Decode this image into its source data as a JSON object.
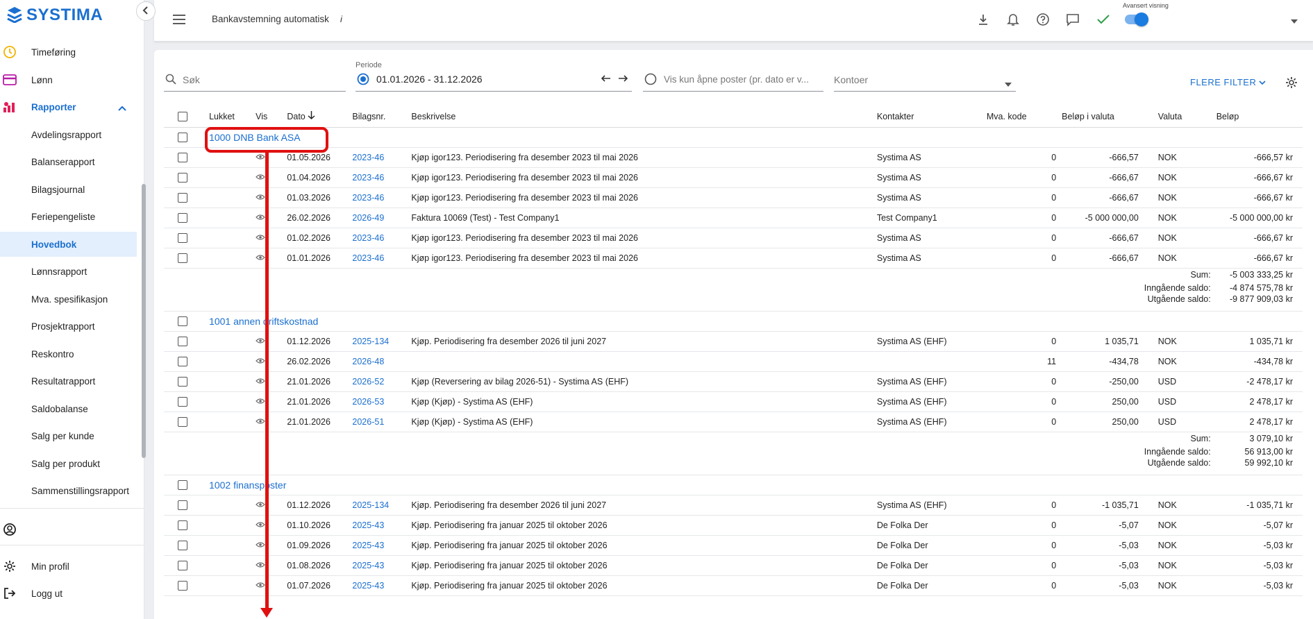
{
  "app": {
    "logo": "SYSTIMA"
  },
  "sidebar": {
    "items": [
      {
        "label": "Timeføring",
        "icon": "clock-icon"
      },
      {
        "label": "Lønn",
        "icon": "payment-card-icon"
      },
      {
        "label": "Rapporter",
        "icon": "reports-icon"
      },
      {
        "label": "Avdelingsrapport"
      },
      {
        "label": "Balanserapport"
      },
      {
        "label": "Bilagsjournal"
      },
      {
        "label": "Feriepengeliste"
      },
      {
        "label": "Hovedbok"
      },
      {
        "label": "Lønnsrapport"
      },
      {
        "label": "Mva. spesifikasjon"
      },
      {
        "label": "Prosjektrapport"
      },
      {
        "label": "Reskontro"
      },
      {
        "label": "Resultatrapport"
      },
      {
        "label": "Saldobalanse"
      },
      {
        "label": "Salg per kunde"
      },
      {
        "label": "Salg per produkt"
      },
      {
        "label": "Sammenstillingsrapport"
      }
    ],
    "bottom": {
      "profile": "Min profil",
      "logout": "Logg ut"
    }
  },
  "topbar": {
    "title": "Bankavstemning automatisk",
    "info": "i",
    "advanced_label": "Avansert visning"
  },
  "filters": {
    "search_placeholder": "Søk",
    "period_label": "Periode",
    "period_value": "01.01.2026 - 31.12.2026",
    "open_posts_label": "Vis kun åpne poster (pr. dato er v...",
    "accounts_placeholder": "Kontoer",
    "more_filters": "FLERE FILTER"
  },
  "columns": {
    "closed": "Lukket",
    "show": "Vis",
    "date": "Dato",
    "voucher": "Bilagsnr.",
    "description": "Beskrivelse",
    "contacts": "Kontakter",
    "vat": "Mva. kode",
    "amount_currency": "Beløp i valuta",
    "currency": "Valuta",
    "amount": "Beløp"
  },
  "groups": [
    {
      "title": "1000 DNB Bank ASA",
      "rows": [
        {
          "date": "01.05.2026",
          "voucher": "2023-46",
          "desc": "Kjøp igor123. Periodisering fra desember 2023 til mai 2026",
          "contact": "Systima AS",
          "vat": "0",
          "amount_cur": "-666,57",
          "currency": "NOK",
          "amount": "-666,57 kr"
        },
        {
          "date": "01.04.2026",
          "voucher": "2023-46",
          "desc": "Kjøp igor123. Periodisering fra desember 2023 til mai 2026",
          "contact": "Systima AS",
          "vat": "0",
          "amount_cur": "-666,67",
          "currency": "NOK",
          "amount": "-666,67 kr"
        },
        {
          "date": "01.03.2026",
          "voucher": "2023-46",
          "desc": "Kjøp igor123. Periodisering fra desember 2023 til mai 2026",
          "contact": "Systima AS",
          "vat": "0",
          "amount_cur": "-666,67",
          "currency": "NOK",
          "amount": "-666,67 kr"
        },
        {
          "date": "26.02.2026",
          "voucher": "2026-49",
          "desc": "Faktura 10069 (Test) - Test Company1",
          "contact": "Test Company1",
          "vat": "0",
          "amount_cur": "-5 000 000,00",
          "currency": "NOK",
          "amount": "-5 000 000,00 kr"
        },
        {
          "date": "01.02.2026",
          "voucher": "2023-46",
          "desc": "Kjøp igor123. Periodisering fra desember 2023 til mai 2026",
          "contact": "Systima AS",
          "vat": "0",
          "amount_cur": "-666,67",
          "currency": "NOK",
          "amount": "-666,67 kr"
        },
        {
          "date": "01.01.2026",
          "voucher": "2023-46",
          "desc": "Kjøp igor123. Periodisering fra desember 2023 til mai 2026",
          "contact": "Systima AS",
          "vat": "0",
          "amount_cur": "-666,67",
          "currency": "NOK",
          "amount": "-666,67 kr"
        }
      ],
      "sum": {
        "sum_label": "Sum:",
        "sum": "-5 003 333,25 kr",
        "in_label": "Inngående saldo:",
        "in": "-4 874 575,78 kr",
        "out_label": "Utgående saldo:",
        "out": "-9 877 909,03 kr"
      }
    },
    {
      "title": "1001 annen driftskostnad",
      "rows": [
        {
          "date": "01.12.2026",
          "voucher": "2025-134",
          "desc": "Kjøp. Periodisering fra desember 2026 til juni 2027",
          "contact": "Systima AS (EHF)",
          "vat": "0",
          "amount_cur": "1 035,71",
          "currency": "NOK",
          "amount": "1 035,71 kr"
        },
        {
          "date": "26.02.2026",
          "voucher": "2026-48",
          "desc": "",
          "contact": "",
          "vat": "11",
          "amount_cur": "-434,78",
          "currency": "NOK",
          "amount": "-434,78 kr"
        },
        {
          "date": "21.01.2026",
          "voucher": "2026-52",
          "desc": "Kjøp (Reversering av bilag 2026-51) - Systima AS (EHF)",
          "contact": "Systima AS (EHF)",
          "vat": "0",
          "amount_cur": "-250,00",
          "currency": "USD",
          "amount": "-2 478,17 kr"
        },
        {
          "date": "21.01.2026",
          "voucher": "2026-53",
          "desc": "Kjøp (Kjøp) - Systima AS (EHF)",
          "contact": "Systima AS (EHF)",
          "vat": "0",
          "amount_cur": "250,00",
          "currency": "USD",
          "amount": "2 478,17 kr"
        },
        {
          "date": "21.01.2026",
          "voucher": "2026-51",
          "desc": "Kjøp (Kjøp) - Systima AS (EHF)",
          "contact": "Systima AS (EHF)",
          "vat": "0",
          "amount_cur": "250,00",
          "currency": "USD",
          "amount": "2 478,17 kr"
        }
      ],
      "sum": {
        "sum_label": "Sum:",
        "sum": "3 079,10 kr",
        "in_label": "Inngående saldo:",
        "in": "56 913,00 kr",
        "out_label": "Utgående saldo:",
        "out": "59 992,10 kr"
      }
    },
    {
      "title": "1002 finansposter",
      "rows": [
        {
          "date": "01.12.2026",
          "voucher": "2025-134",
          "desc": "Kjøp. Periodisering fra desember 2026 til juni 2027",
          "contact": "Systima AS (EHF)",
          "vat": "0",
          "amount_cur": "-1 035,71",
          "currency": "NOK",
          "amount": "-1 035,71 kr"
        },
        {
          "date": "01.10.2026",
          "voucher": "2025-43",
          "desc": "Kjøp. Periodisering fra januar 2025 til oktober 2026",
          "contact": "De Folka Der",
          "vat": "0",
          "amount_cur": "-5,07",
          "currency": "NOK",
          "amount": "-5,07 kr"
        },
        {
          "date": "01.09.2026",
          "voucher": "2025-43",
          "desc": "Kjøp. Periodisering fra januar 2025 til oktober 2026",
          "contact": "De Folka Der",
          "vat": "0",
          "amount_cur": "-5,03",
          "currency": "NOK",
          "amount": "-5,03 kr"
        },
        {
          "date": "01.08.2026",
          "voucher": "2025-43",
          "desc": "Kjøp. Periodisering fra januar 2025 til oktober 2026",
          "contact": "De Folka Der",
          "vat": "0",
          "amount_cur": "-5,03",
          "currency": "NOK",
          "amount": "-5,03 kr"
        },
        {
          "date": "01.07.2026",
          "voucher": "2025-43",
          "desc": "Kjøp. Periodisering fra januar 2025 til oktober 2026",
          "contact": "De Folka Der",
          "vat": "0",
          "amount_cur": "-5,03",
          "currency": "NOK",
          "amount": "-5,03 kr"
        }
      ]
    }
  ],
  "colors": {
    "accent": "#1a6fd0",
    "annotation": "#e01010",
    "active_bg": "#e3effc"
  }
}
